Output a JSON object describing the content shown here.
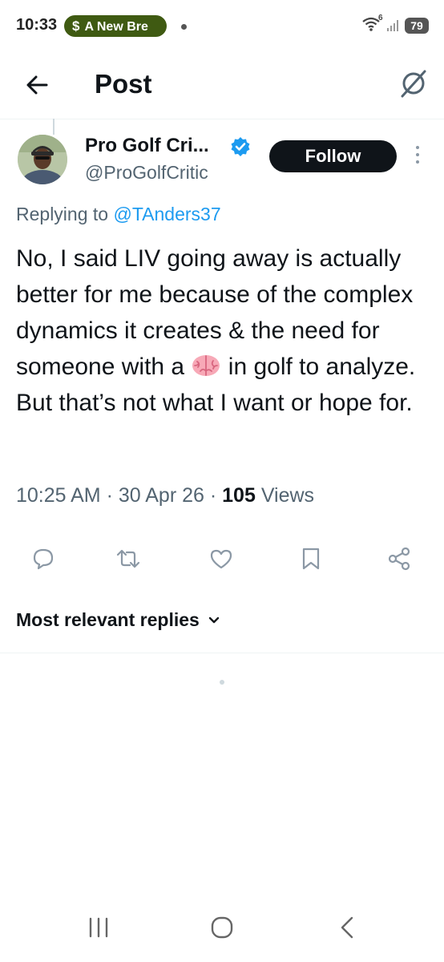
{
  "status_bar": {
    "time": "10:33",
    "notification_pill": "A New Bre",
    "notification_icon": "dollar-sign",
    "wifi_badge": "6",
    "battery": "79"
  },
  "header": {
    "title": "Post",
    "back_icon": "arrow-left-icon",
    "grok_icon": "grok-icon"
  },
  "post": {
    "author": {
      "display_name": "Pro Golf Cri...",
      "handle": "@ProGolfCritic",
      "verified": true
    },
    "follow_label": "Follow",
    "replying_prefix": "Replying to",
    "replying_to": "@TAnders37",
    "text_before_emoji": "No, I said LIV going away is actually better for me because of the complex dynamics it creates & the need for someone with a ",
    "emoji": "brain",
    "text_after_emoji": " in golf to analyze.",
    "text_line2": "But that’s not what I want or hope for.",
    "time": "10:25 AM",
    "separator": "·",
    "date": "30 Apr 26",
    "views_count": "105",
    "views_label": "Views"
  },
  "actions": [
    "reply",
    "repost",
    "like",
    "bookmark",
    "share"
  ],
  "replies": {
    "sort_label": "Most relevant replies"
  },
  "colors": {
    "accent": "#1d9bf0",
    "text": "#0f1419",
    "secondary": "#536471",
    "pill": "#3f5a12"
  }
}
